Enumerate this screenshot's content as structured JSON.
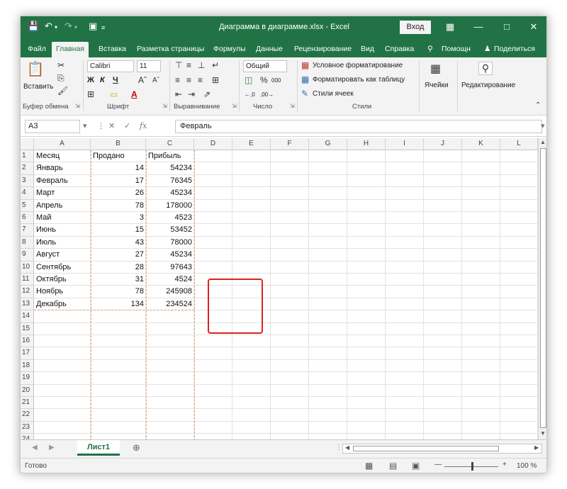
{
  "titlebar": {
    "title": "Диаграмма в диаграмме.xlsx  -  Excel",
    "login": "Вход",
    "accent": "#217346"
  },
  "tabs": [
    "Файл",
    "Главная",
    "Вставка",
    "Разметка страницы",
    "Формулы",
    "Данные",
    "Рецензирование",
    "Вид",
    "Справка"
  ],
  "tell_me": "Помощн",
  "share": "Поделиться",
  "ribbon": {
    "paste": "Вставить",
    "font_name": "Calibri",
    "font_size": "11",
    "bold": "Ж",
    "italic": "К",
    "underline": "Ч",
    "number_format": "Общий",
    "conditional": "Условное форматирование",
    "format_table": "Форматировать как таблицу",
    "cell_styles": "Стили ячеек",
    "cells": "Ячейки",
    "editing": "Редактирование",
    "groups": {
      "clipboard": "Буфер обмена",
      "font": "Шрифт",
      "alignment": "Выравнивание",
      "number": "Число",
      "styles": "Стили"
    }
  },
  "formula_bar": {
    "name_box": "A3",
    "content": "Февраль",
    "fx": "fx"
  },
  "columns": [
    "A",
    "B",
    "C",
    "D",
    "E",
    "F",
    "G",
    "H",
    "I",
    "J",
    "K",
    "L"
  ],
  "rows": [
    "1",
    "2",
    "3",
    "4",
    "5",
    "6",
    "7",
    "8",
    "9",
    "10",
    "11",
    "12",
    "13",
    "14",
    "15",
    "16",
    "17",
    "18",
    "19",
    "20",
    "21",
    "22",
    "23",
    "24"
  ],
  "table": {
    "headers": [
      "Месяц",
      "Продано",
      "Прибыль"
    ],
    "data": [
      [
        "Январь",
        "14",
        "54234"
      ],
      [
        "Февраль",
        "17",
        "76345"
      ],
      [
        "Март",
        "26",
        "45234"
      ],
      [
        "Апрель",
        "78",
        "178000"
      ],
      [
        "Май",
        "3",
        "4523"
      ],
      [
        "Июнь",
        "15",
        "53452"
      ],
      [
        "Июль",
        "43",
        "78000"
      ],
      [
        "Август",
        "27",
        "45234"
      ],
      [
        "Сентябрь",
        "28",
        "97643"
      ],
      [
        "Октябрь",
        "31",
        "4524"
      ],
      [
        "Ноябрь",
        "78",
        "245908"
      ],
      [
        "Декабрь",
        "134",
        "234524"
      ]
    ]
  },
  "sheet_tab": "Лист1",
  "status": {
    "ready": "Готово",
    "zoom": "100 %"
  }
}
